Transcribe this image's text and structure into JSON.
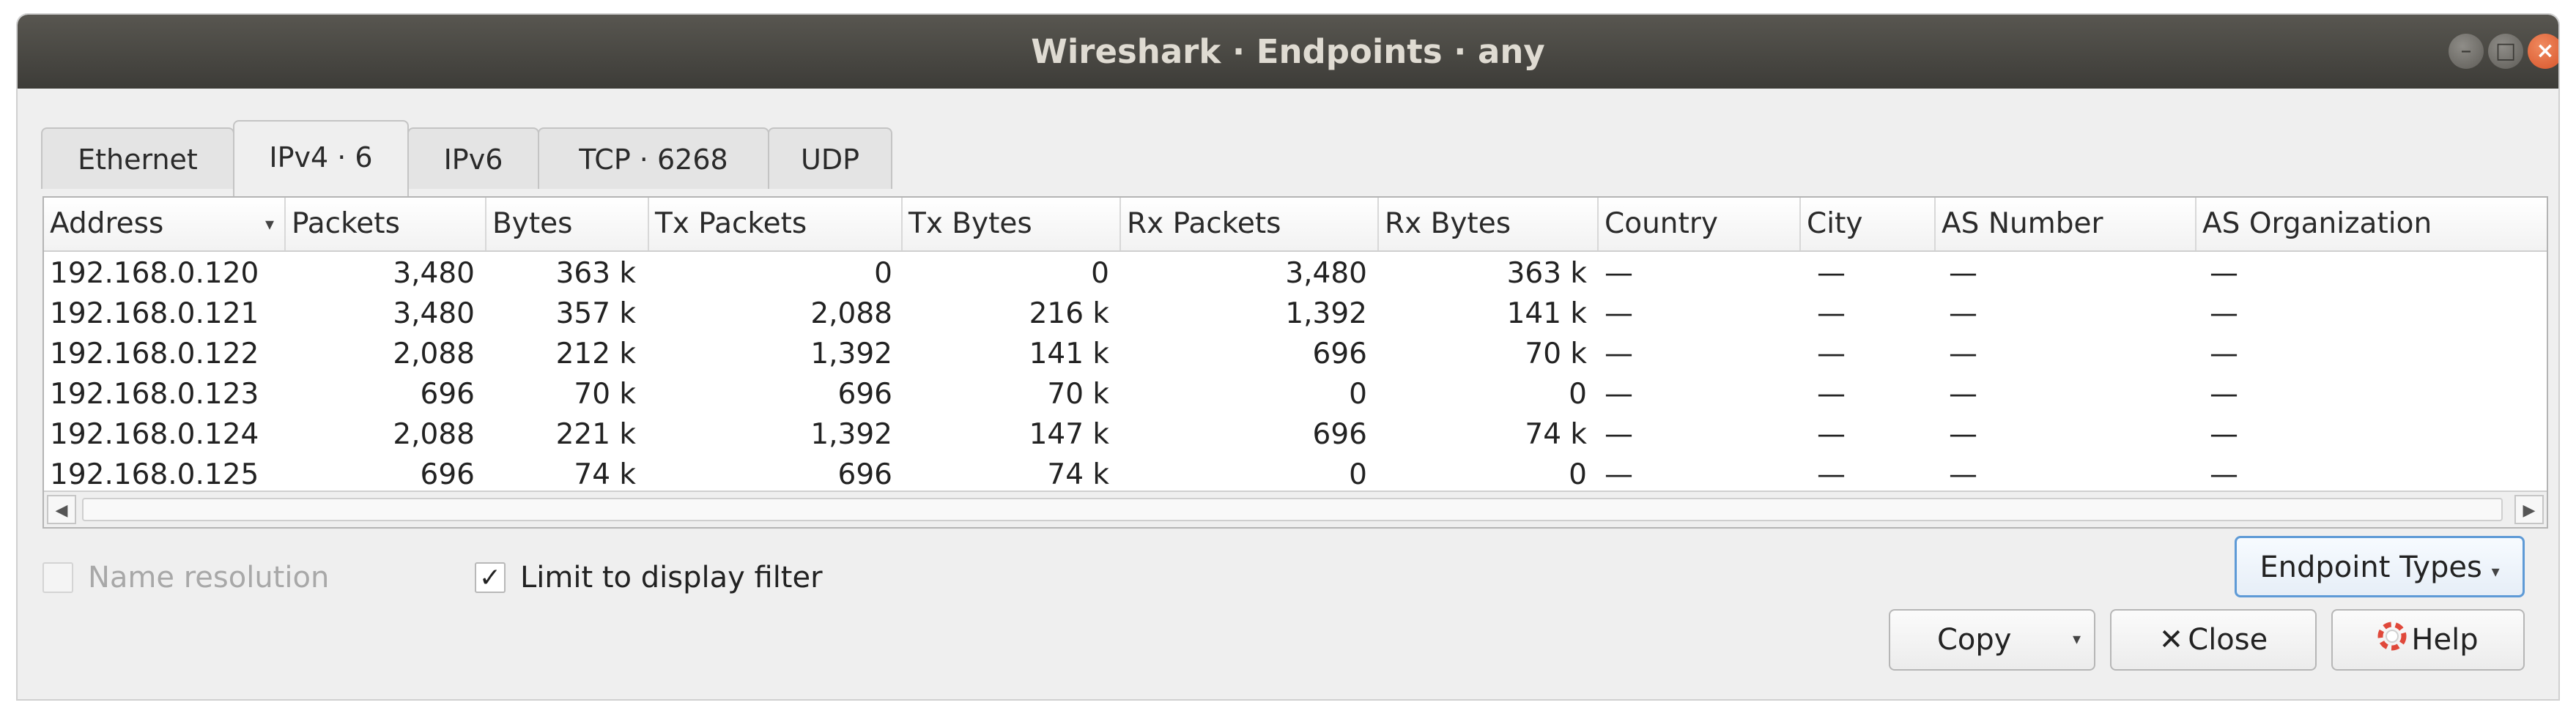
{
  "window": {
    "title": "Wireshark · Endpoints · any",
    "controls": {
      "minimize": "–",
      "maximize": "□",
      "close": "×"
    }
  },
  "tabs": [
    {
      "label": "Ethernet",
      "active": false
    },
    {
      "label": "IPv4 · 6",
      "active": true
    },
    {
      "label": "IPv6",
      "active": false
    },
    {
      "label": "TCP · 6268",
      "active": false
    },
    {
      "label": "UDP",
      "active": false
    }
  ],
  "table": {
    "columns": [
      "Address",
      "Packets",
      "Bytes",
      "Tx Packets",
      "Tx Bytes",
      "Rx Packets",
      "Rx Bytes",
      "Country",
      "City",
      "AS Number",
      "AS Organization"
    ],
    "sort_indicator": "▾",
    "rows": [
      [
        "192.168.0.120",
        "3,480",
        "363 k",
        "0",
        "0",
        "3,480",
        "363 k",
        "—",
        "—",
        "—",
        "—"
      ],
      [
        "192.168.0.121",
        "3,480",
        "357 k",
        "2,088",
        "216 k",
        "1,392",
        "141 k",
        "—",
        "—",
        "—",
        "—"
      ],
      [
        "192.168.0.122",
        "2,088",
        "212 k",
        "1,392",
        "141 k",
        "696",
        "70 k",
        "—",
        "—",
        "—",
        "—"
      ],
      [
        "192.168.0.123",
        "696",
        "70 k",
        "696",
        "70 k",
        "0",
        "0",
        "—",
        "—",
        "—",
        "—"
      ],
      [
        "192.168.0.124",
        "2,088",
        "221 k",
        "1,392",
        "147 k",
        "696",
        "74 k",
        "—",
        "—",
        "—",
        "—"
      ],
      [
        "192.168.0.125",
        "696",
        "74 k",
        "696",
        "74 k",
        "0",
        "0",
        "—",
        "—",
        "—",
        "—"
      ]
    ],
    "scroll_left": "◀",
    "scroll_right": "▶"
  },
  "options": {
    "name_resolution": {
      "label": "Name resolution",
      "checked": false,
      "enabled": false
    },
    "limit_to_display_filter": {
      "label": "Limit to display filter",
      "checked": true,
      "enabled": true,
      "mark": "✓"
    }
  },
  "buttons": {
    "endpoint_types": "Endpoint Types",
    "copy": "Copy",
    "close": "Close",
    "help": "Help",
    "dropdown_caret": "▾",
    "close_glyph": "✕"
  },
  "colors": {
    "titlebar": "#3d3c38",
    "close_button": "#d7542a",
    "focus_border": "#5e9ad6",
    "help_icon": "#e0483a"
  }
}
